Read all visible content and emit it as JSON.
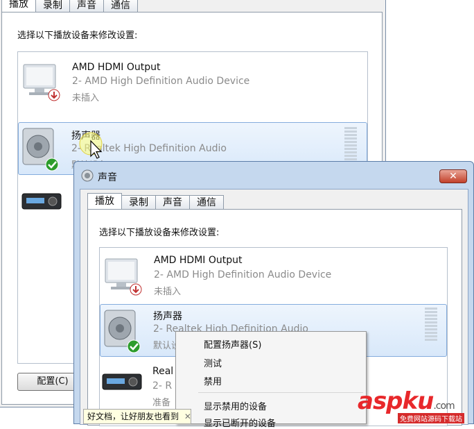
{
  "tabs": [
    "播放",
    "录制",
    "声音",
    "通信"
  ],
  "instruction": "选择以下播放设备来修改设置:",
  "devices": [
    {
      "name": "AMD HDMI Output",
      "description": "2- AMD High Definition Audio Device",
      "status": "未插入"
    },
    {
      "name": "扬声器",
      "description": "2- Realtek High Definition Audio",
      "status": "默认设备"
    },
    {
      "name": "Real",
      "description": "2- R",
      "status": "准备"
    }
  ],
  "bg_buttons": {
    "configure": "配置(C)"
  },
  "fg_window": {
    "title": "声音",
    "close": "✕"
  },
  "context_menu": {
    "items": [
      "配置扬声器(S)",
      "测试",
      "禁用",
      "显示禁用的设备",
      "显示已断开的设备"
    ]
  },
  "tooltip": {
    "text": "好文档，让好朋友也看到",
    "close": "✕"
  },
  "watermark": {
    "brand": "aspku",
    "tld": ".com",
    "slogan": "免费网站源码下载站"
  },
  "colors": {
    "selection": "#d8e8fa",
    "close_button": "#c2412a",
    "watermark": "#e8282b"
  }
}
